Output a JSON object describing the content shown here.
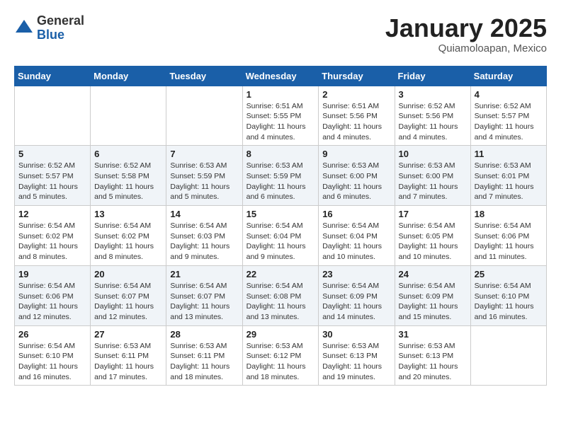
{
  "header": {
    "logo_general": "General",
    "logo_blue": "Blue",
    "month_title": "January 2025",
    "location": "Quiamoloapan, Mexico"
  },
  "days_of_week": [
    "Sunday",
    "Monday",
    "Tuesday",
    "Wednesday",
    "Thursday",
    "Friday",
    "Saturday"
  ],
  "weeks": [
    [
      {
        "day": "",
        "info": ""
      },
      {
        "day": "",
        "info": ""
      },
      {
        "day": "",
        "info": ""
      },
      {
        "day": "1",
        "info": "Sunrise: 6:51 AM\nSunset: 5:55 PM\nDaylight: 11 hours and 4 minutes."
      },
      {
        "day": "2",
        "info": "Sunrise: 6:51 AM\nSunset: 5:56 PM\nDaylight: 11 hours and 4 minutes."
      },
      {
        "day": "3",
        "info": "Sunrise: 6:52 AM\nSunset: 5:56 PM\nDaylight: 11 hours and 4 minutes."
      },
      {
        "day": "4",
        "info": "Sunrise: 6:52 AM\nSunset: 5:57 PM\nDaylight: 11 hours and 4 minutes."
      }
    ],
    [
      {
        "day": "5",
        "info": "Sunrise: 6:52 AM\nSunset: 5:57 PM\nDaylight: 11 hours and 5 minutes."
      },
      {
        "day": "6",
        "info": "Sunrise: 6:52 AM\nSunset: 5:58 PM\nDaylight: 11 hours and 5 minutes."
      },
      {
        "day": "7",
        "info": "Sunrise: 6:53 AM\nSunset: 5:59 PM\nDaylight: 11 hours and 5 minutes."
      },
      {
        "day": "8",
        "info": "Sunrise: 6:53 AM\nSunset: 5:59 PM\nDaylight: 11 hours and 6 minutes."
      },
      {
        "day": "9",
        "info": "Sunrise: 6:53 AM\nSunset: 6:00 PM\nDaylight: 11 hours and 6 minutes."
      },
      {
        "day": "10",
        "info": "Sunrise: 6:53 AM\nSunset: 6:00 PM\nDaylight: 11 hours and 7 minutes."
      },
      {
        "day": "11",
        "info": "Sunrise: 6:53 AM\nSunset: 6:01 PM\nDaylight: 11 hours and 7 minutes."
      }
    ],
    [
      {
        "day": "12",
        "info": "Sunrise: 6:54 AM\nSunset: 6:02 PM\nDaylight: 11 hours and 8 minutes."
      },
      {
        "day": "13",
        "info": "Sunrise: 6:54 AM\nSunset: 6:02 PM\nDaylight: 11 hours and 8 minutes."
      },
      {
        "day": "14",
        "info": "Sunrise: 6:54 AM\nSunset: 6:03 PM\nDaylight: 11 hours and 9 minutes."
      },
      {
        "day": "15",
        "info": "Sunrise: 6:54 AM\nSunset: 6:04 PM\nDaylight: 11 hours and 9 minutes."
      },
      {
        "day": "16",
        "info": "Sunrise: 6:54 AM\nSunset: 6:04 PM\nDaylight: 11 hours and 10 minutes."
      },
      {
        "day": "17",
        "info": "Sunrise: 6:54 AM\nSunset: 6:05 PM\nDaylight: 11 hours and 10 minutes."
      },
      {
        "day": "18",
        "info": "Sunrise: 6:54 AM\nSunset: 6:06 PM\nDaylight: 11 hours and 11 minutes."
      }
    ],
    [
      {
        "day": "19",
        "info": "Sunrise: 6:54 AM\nSunset: 6:06 PM\nDaylight: 11 hours and 12 minutes."
      },
      {
        "day": "20",
        "info": "Sunrise: 6:54 AM\nSunset: 6:07 PM\nDaylight: 11 hours and 12 minutes."
      },
      {
        "day": "21",
        "info": "Sunrise: 6:54 AM\nSunset: 6:07 PM\nDaylight: 11 hours and 13 minutes."
      },
      {
        "day": "22",
        "info": "Sunrise: 6:54 AM\nSunset: 6:08 PM\nDaylight: 11 hours and 13 minutes."
      },
      {
        "day": "23",
        "info": "Sunrise: 6:54 AM\nSunset: 6:09 PM\nDaylight: 11 hours and 14 minutes."
      },
      {
        "day": "24",
        "info": "Sunrise: 6:54 AM\nSunset: 6:09 PM\nDaylight: 11 hours and 15 minutes."
      },
      {
        "day": "25",
        "info": "Sunrise: 6:54 AM\nSunset: 6:10 PM\nDaylight: 11 hours and 16 minutes."
      }
    ],
    [
      {
        "day": "26",
        "info": "Sunrise: 6:54 AM\nSunset: 6:10 PM\nDaylight: 11 hours and 16 minutes."
      },
      {
        "day": "27",
        "info": "Sunrise: 6:53 AM\nSunset: 6:11 PM\nDaylight: 11 hours and 17 minutes."
      },
      {
        "day": "28",
        "info": "Sunrise: 6:53 AM\nSunset: 6:11 PM\nDaylight: 11 hours and 18 minutes."
      },
      {
        "day": "29",
        "info": "Sunrise: 6:53 AM\nSunset: 6:12 PM\nDaylight: 11 hours and 18 minutes."
      },
      {
        "day": "30",
        "info": "Sunrise: 6:53 AM\nSunset: 6:13 PM\nDaylight: 11 hours and 19 minutes."
      },
      {
        "day": "31",
        "info": "Sunrise: 6:53 AM\nSunset: 6:13 PM\nDaylight: 11 hours and 20 minutes."
      },
      {
        "day": "",
        "info": ""
      }
    ]
  ]
}
